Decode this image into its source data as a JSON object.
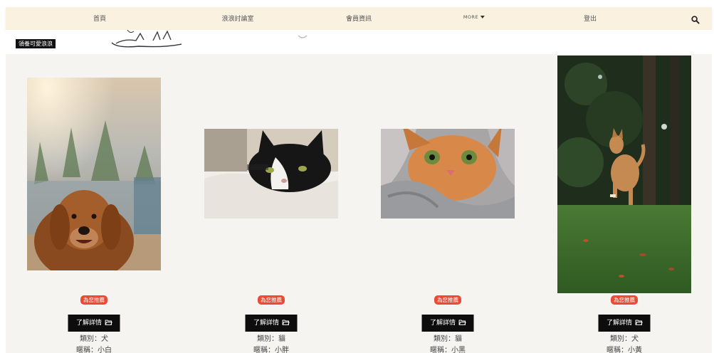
{
  "nav": {
    "items": [
      "首頁",
      "浪浪討論室",
      "會員資訊",
      "MORE",
      "登出"
    ]
  },
  "banner": {
    "label": "領養可愛浪浪"
  },
  "cards": [
    {
      "badge": "為您推薦",
      "button_label": "了解詳情",
      "species_text": "類別：犬",
      "name_text": "暱稱：小白"
    },
    {
      "badge": "為您推薦",
      "button_label": "了解詳情",
      "species_text": "類別：貓",
      "name_text": "暱稱：小胖"
    },
    {
      "badge": "為您推薦",
      "button_label": "了解詳情",
      "species_text": "類別：貓",
      "name_text": "暱稱：小黑"
    },
    {
      "badge": "為您推薦",
      "button_label": "了解詳情",
      "species_text": "類別：犬",
      "name_text": "暱稱：小黃"
    }
  ],
  "colors": {
    "navbar_bg": "#fbf1e0",
    "content_bg": "#f6f4f1",
    "badge_bg": "#e94b35",
    "button_bg": "#0d0d0d"
  },
  "icons": [
    "search-icon",
    "caret-down-icon",
    "folder-open-icon"
  ]
}
